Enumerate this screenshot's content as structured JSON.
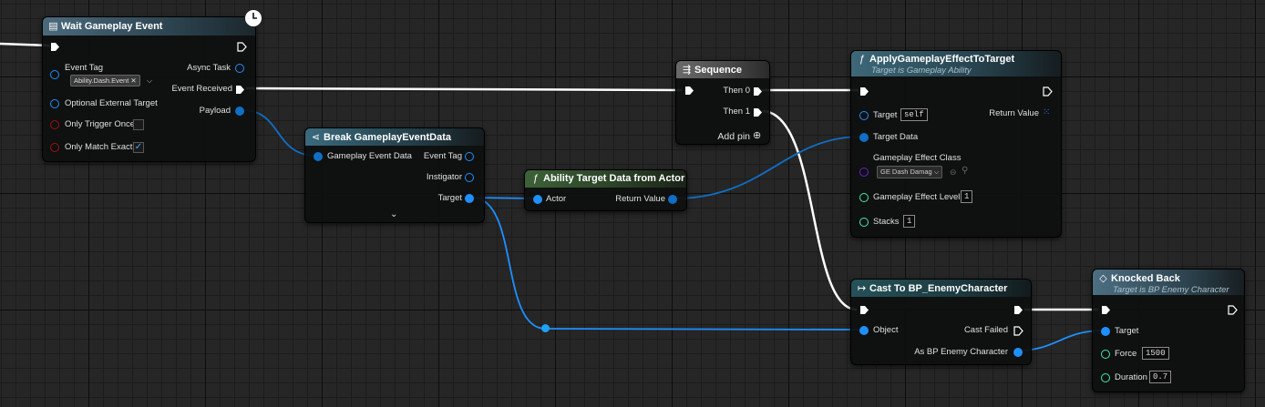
{
  "colors": {
    "exec": "#ffffff",
    "object_pin": "#1e90ff",
    "struct_pin": "#0f6fc5",
    "float_pin": "#3ef0a0",
    "int_pin": "#3ef0c0",
    "bool_pin": "#a01010",
    "class_pin": "#6a1fd0",
    "function_header": "#3d6878",
    "event_header": "#4a6a7c",
    "cast_header": "#255158",
    "sequence_header": "#555555",
    "pure_header": "#3d6138"
  },
  "wait_event": {
    "title": "Wait Gameplay Event",
    "event_tag_label": "Event Tag",
    "event_tag_value": "Ability.Dash.Event",
    "optional_target_label": "Optional External Target",
    "trigger_once_label": "Only Trigger Once",
    "match_exact_label": "Only Match Exact",
    "trigger_once_checked": false,
    "match_exact_checked": true,
    "async_task_label": "Async Task",
    "event_received_label": "Event Received",
    "payload_label": "Payload"
  },
  "break_event": {
    "title": "Break GameplayEventData",
    "input_label": "Gameplay Event Data",
    "event_tag_label": "Event Tag",
    "instigator_label": "Instigator",
    "target_label": "Target"
  },
  "target_data": {
    "title": "Ability Target Data from Actor",
    "actor_label": "Actor",
    "return_label": "Return Value"
  },
  "sequence": {
    "title": "Sequence",
    "then0_label": "Then 0",
    "then1_label": "Then 1",
    "add_pin_label": "Add pin"
  },
  "apply_effect": {
    "title": "ApplyGameplayEffectToTarget",
    "subtitle": "Target is Gameplay Ability",
    "target_label": "Target",
    "target_value": "self",
    "return_label": "Return Value",
    "target_data_label": "Target Data",
    "effect_class_label": "Gameplay Effect Class",
    "effect_class_value": "GE Dash Damag",
    "effect_level_label": "Gameplay Effect Level",
    "effect_level_value": "1",
    "stacks_label": "Stacks",
    "stacks_value": "1"
  },
  "cast_node": {
    "title": "Cast To BP_EnemyCharacter",
    "object_label": "Object",
    "cast_failed_label": "Cast Failed",
    "as_label": "As BP Enemy Character"
  },
  "knocked_back": {
    "title": "Knocked Back",
    "subtitle": "Target is BP Enemy Character",
    "target_label": "Target",
    "force_label": "Force",
    "force_value": "1500",
    "duration_label": "Duration",
    "duration_value": "0.7"
  }
}
